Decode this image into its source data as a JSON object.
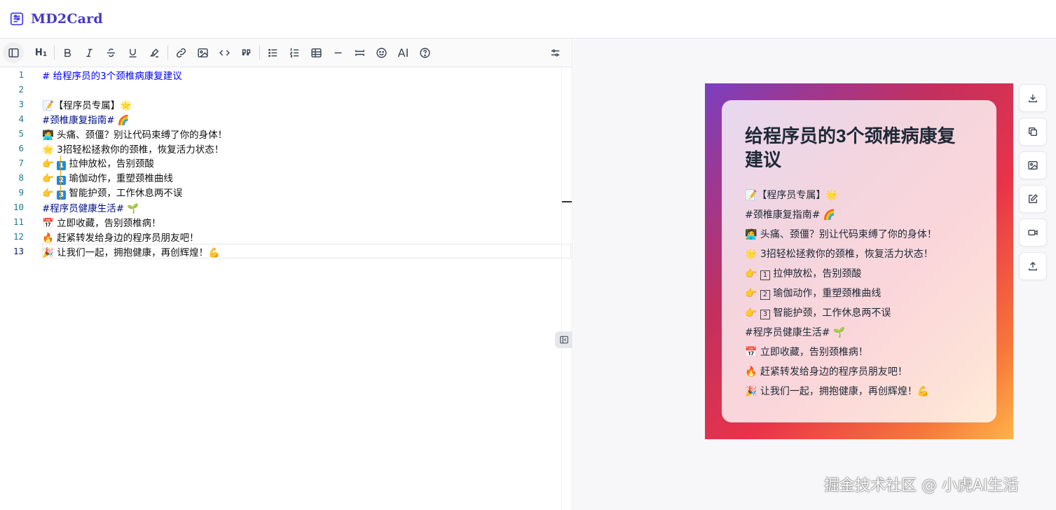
{
  "app": {
    "title": "MD2Card"
  },
  "toolbar": {
    "heading": "H",
    "heading_sub": "1",
    "ai_label": "AI"
  },
  "editor": {
    "lines": [
      {
        "num": "1",
        "text": "# 给程序员的3个颈椎病康复建议"
      },
      {
        "num": "2",
        "text": ""
      },
      {
        "num": "3",
        "text": "📝【程序员专属】🌟"
      },
      {
        "num": "4",
        "text": "#颈椎康复指南# 🌈"
      },
      {
        "num": "5",
        "text": "🧑‍💻 头痛、颈僵？别让代码束缚了你的身体！"
      },
      {
        "num": "6",
        "text": "🌟 3招轻松拯救你的颈椎，恢复活力状态！"
      },
      {
        "num": "7",
        "text": "👉 ",
        "key": "1",
        "tail": " 拉伸放松，告别颈酸"
      },
      {
        "num": "8",
        "text": "👉 ",
        "key": "2",
        "tail": " 瑜伽动作，重塑颈椎曲线"
      },
      {
        "num": "9",
        "text": "👉 ",
        "key": "3",
        "tail": " 智能护颈，工作休息两不误"
      },
      {
        "num": "10",
        "text": "#程序员健康生活# 🌱"
      },
      {
        "num": "11",
        "text": "📅 立即收藏，告别颈椎病！"
      },
      {
        "num": "12",
        "text": "🔥 赶紧转发给身边的程序员朋友吧！"
      },
      {
        "num": "13",
        "text": "🎉 让我们一起，拥抱健康，再创辉煌！💪"
      }
    ]
  },
  "card": {
    "title": "给程序员的3个颈椎病康复建议",
    "lines": [
      "📝【程序员专属】🌟",
      "#颈椎康复指南# 🌈",
      "🧑‍💻 头痛、颈僵？别让代码束缚了你的身体！",
      "🌟 3招轻松拯救你的颈椎，恢复活力状态！",
      "👉 1 拉伸放松，告别颈酸",
      "👉 2 瑜伽动作，重塑颈椎曲线",
      "👉 3 智能护颈，工作休息两不误",
      "#程序员健康生活# 🌱",
      "📅 立即收藏，告别颈椎病！",
      "🔥 赶紧转发给身边的程序员朋友吧！",
      "🎉 让我们一起，拥抱健康，再创辉煌！💪"
    ],
    "keys": [
      "1",
      "2",
      "3"
    ],
    "key_tails": [
      " 拉伸放松，告别颈酸",
      " 瑜伽动作，重塑颈椎曲线",
      " 智能护颈，工作休息两不误"
    ]
  },
  "watermark": "掘金技术社区 @ 小虎AI生活",
  "colors": {
    "brand": "#4338ca",
    "line_number": "#237893",
    "markdown_heading": "#0000ff"
  }
}
